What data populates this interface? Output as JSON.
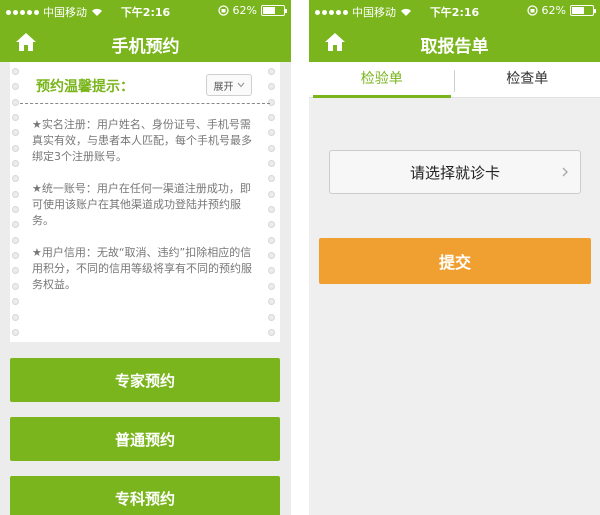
{
  "left": {
    "status": {
      "carrier": "中国移动",
      "time": "下午2:16",
      "battery": "62%",
      "battery_level": 0.62
    },
    "nav": {
      "title": "手机预约"
    },
    "tip": {
      "title": "预约温馨提示：",
      "expand_label": "展开",
      "paragraphs": [
        "★实名注册：用户姓名、身份证号、手机号需真实有效，与患者本人匹配，每个手机号最多绑定3个注册账号。",
        "★统一账号：用户在任何一渠道注册成功，即可使用该账户在其他渠道成功登陆并预约服务。",
        "★用户信用：无故“取消、违约”扣除相应的信用积分，不同的信用等级将享有不同的预约服务权益。"
      ]
    },
    "buttons": [
      "专家预约",
      "普通预约",
      "专科预约"
    ]
  },
  "right": {
    "status": {
      "carrier": "中国移动",
      "time": "下午2:16",
      "battery": "62%",
      "battery_level": 0.62
    },
    "nav": {
      "title": "取报告单"
    },
    "tabs": [
      "检验单",
      "检查单"
    ],
    "select_label": "请选择就诊卡",
    "submit_label": "提交"
  }
}
